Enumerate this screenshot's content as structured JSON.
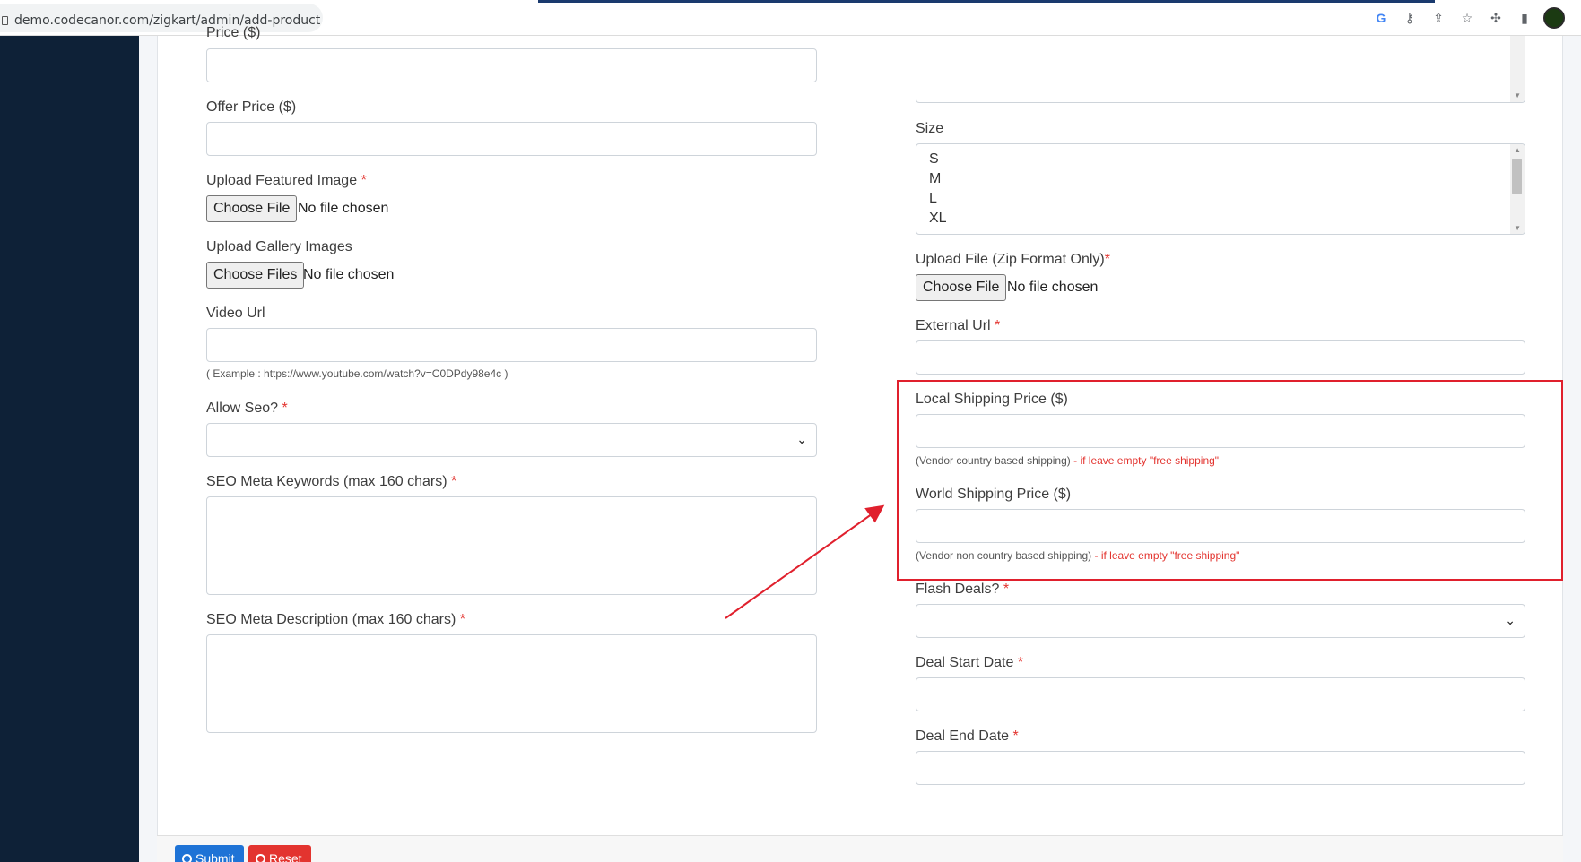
{
  "browser": {
    "url": "demo.codecanor.com/zigkart/admin/add-product",
    "toolbar_icons": [
      "google-icon",
      "key-icon",
      "share-icon",
      "star-icon",
      "puzzle-icon",
      "sidepanel-icon",
      "avatar"
    ]
  },
  "form_left": {
    "price_label": "Price ($)",
    "offer_price_label": "Offer Price ($)",
    "featured_image_label": "Upload Featured Image",
    "featured_image_button": "Choose File",
    "featured_image_status": "No file chosen",
    "gallery_label": "Upload Gallery Images",
    "gallery_button": "Choose Files",
    "gallery_status": "No file chosen",
    "video_url_label": "Video Url",
    "video_url_help": "( Example : https://www.youtube.com/watch?v=C0DPdy98e4c )",
    "allow_seo_label": "Allow Seo?",
    "seo_keywords_label": "SEO Meta Keywords (max 160 chars)",
    "seo_description_label": "SEO Meta Description (max 160 chars)"
  },
  "form_right": {
    "size_label": "Size",
    "size_options": [
      "S",
      "M",
      "L",
      "XL"
    ],
    "upload_zip_label": "Upload File (Zip Format Only)",
    "upload_zip_button": "Choose File",
    "upload_zip_status": "No file chosen",
    "external_url_label": "External Url",
    "local_shipping_label": "Local Shipping Price ($)",
    "local_shipping_help": "(Vendor country based shipping)",
    "local_shipping_warn": "- if leave empty \"free shipping\"",
    "world_shipping_label": "World Shipping Price ($)",
    "world_shipping_help": "(Vendor non country based shipping)",
    "world_shipping_warn": "- if leave empty \"free shipping\"",
    "flash_deals_label": "Flash Deals?",
    "deal_start_label": "Deal Start Date",
    "deal_end_label": "Deal End Date"
  },
  "required_mark": "*",
  "buttons": {
    "submit": "Submit",
    "reset": "Reset"
  },
  "colors": {
    "sidebar": "#0e2137",
    "required": "#e3342f",
    "annotation": "#e0202d",
    "submit": "#1e73d6",
    "reset": "#e3342f"
  }
}
